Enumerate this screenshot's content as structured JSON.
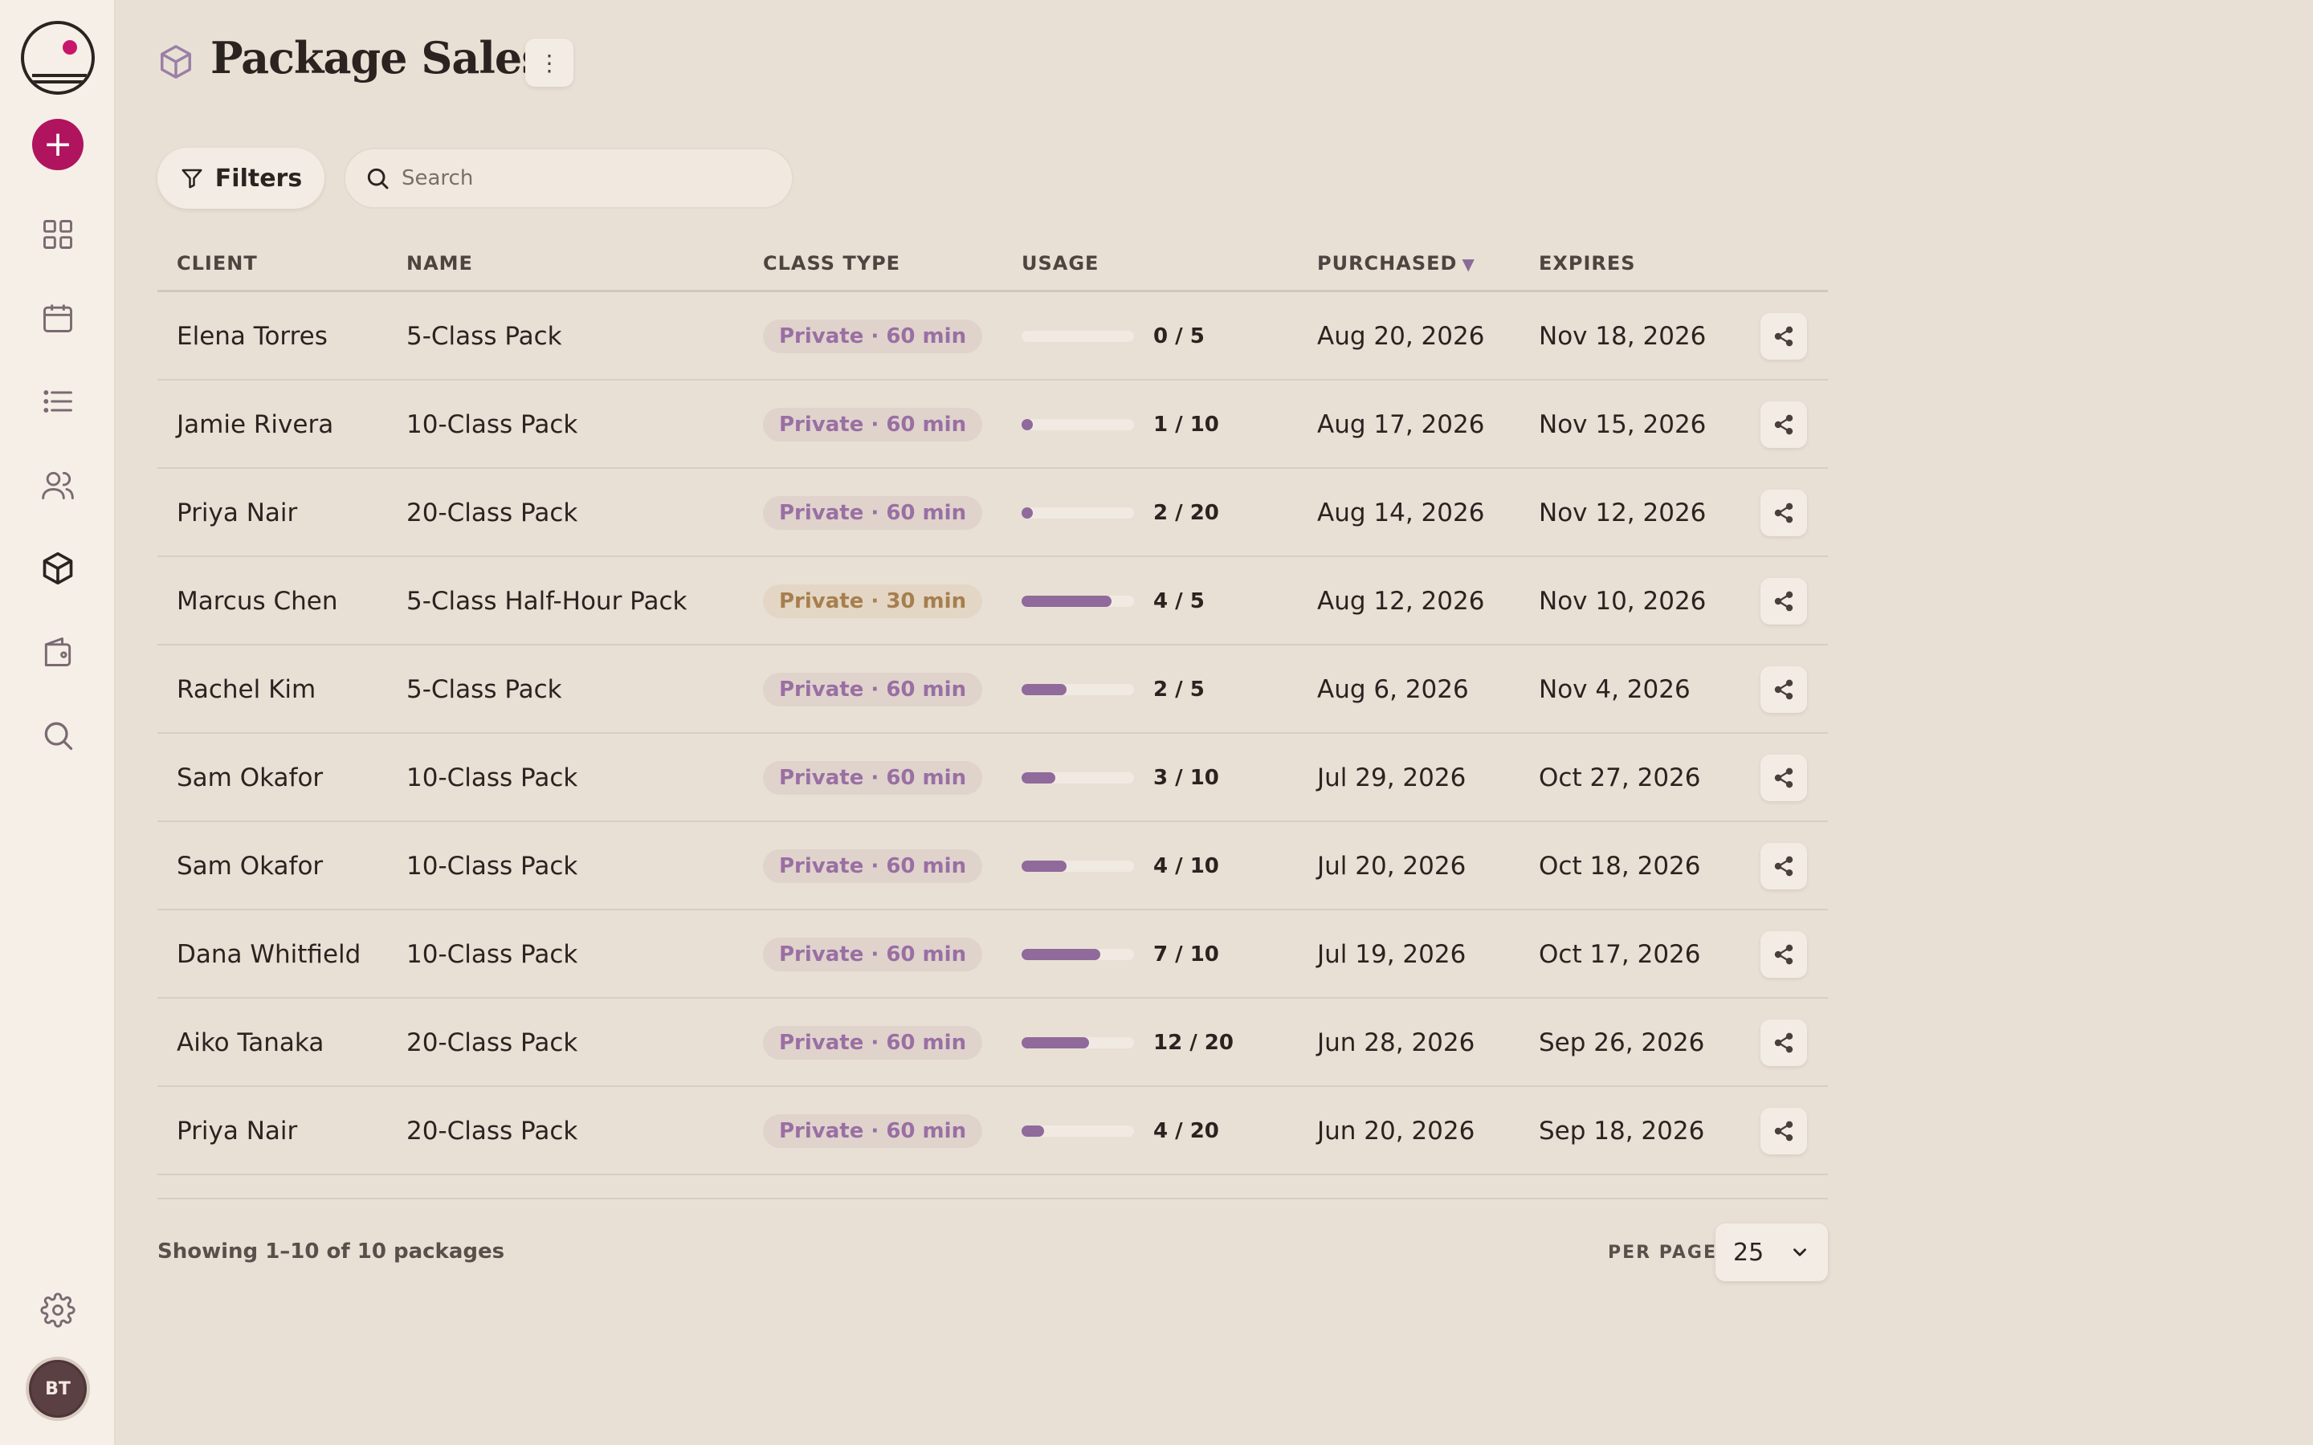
{
  "sidebar": {
    "items": [
      {
        "icon": "dashboard-icon"
      },
      {
        "icon": "calendar-icon"
      },
      {
        "icon": "list-icon"
      },
      {
        "icon": "clients-icon"
      },
      {
        "icon": "package-icon",
        "active": true
      },
      {
        "icon": "wallet-icon"
      },
      {
        "icon": "search-icon"
      }
    ],
    "add_label": "+",
    "user_initials": "BT"
  },
  "header": {
    "title": "Package Sales",
    "menu_glyph": "⋮"
  },
  "toolbar": {
    "filters_label": "Filters",
    "search_placeholder": "Search"
  },
  "table": {
    "columns": {
      "client": "CLIENT",
      "name": "NAME",
      "class_type": "CLASS TYPE",
      "usage": "USAGE",
      "purchased": "PURCHASED",
      "expires": "EXPIRES"
    },
    "sort_indicator": "▼",
    "rows": [
      {
        "client": "Elena Torres",
        "name": "5-Class Pack",
        "class_type": "Private · 60 min",
        "used": 0,
        "total": 5,
        "usage": "0 / 5",
        "purchased": "Aug 20, 2026",
        "expires": "Nov 18, 2026"
      },
      {
        "client": "Jamie Rivera",
        "name": "10-Class Pack",
        "class_type": "Private · 60 min",
        "used": 1,
        "total": 10,
        "usage": "1 / 10",
        "purchased": "Aug 17, 2026",
        "expires": "Nov 15, 2026"
      },
      {
        "client": "Priya Nair",
        "name": "20-Class Pack",
        "class_type": "Private · 60 min",
        "used": 2,
        "total": 20,
        "usage": "2 / 20",
        "purchased": "Aug 14, 2026",
        "expires": "Nov 12, 2026"
      },
      {
        "client": "Marcus Chen",
        "name": "5-Class Half-Hour Pack",
        "class_type": "Private · 30 min",
        "used": 4,
        "total": 5,
        "usage": "4 / 5",
        "purchased": "Aug 12, 2026",
        "expires": "Nov 10, 2026"
      },
      {
        "client": "Rachel Kim",
        "name": "5-Class Pack",
        "class_type": "Private · 60 min",
        "used": 2,
        "total": 5,
        "usage": "2 / 5",
        "purchased": "Aug 6, 2026",
        "expires": "Nov 4, 2026"
      },
      {
        "client": "Sam Okafor",
        "name": "10-Class Pack",
        "class_type": "Private · 60 min",
        "used": 3,
        "total": 10,
        "usage": "3 / 10",
        "purchased": "Jul 29, 2026",
        "expires": "Oct 27, 2026"
      },
      {
        "client": "Sam Okafor",
        "name": "10-Class Pack",
        "class_type": "Private · 60 min",
        "used": 4,
        "total": 10,
        "usage": "4 / 10",
        "purchased": "Jul 20, 2026",
        "expires": "Oct 18, 2026"
      },
      {
        "client": "Dana Whitfield",
        "name": "10-Class Pack",
        "class_type": "Private · 60 min",
        "used": 7,
        "total": 10,
        "usage": "7 / 10",
        "purchased": "Jul 19, 2026",
        "expires": "Oct 17, 2026"
      },
      {
        "client": "Aiko Tanaka",
        "name": "20-Class Pack",
        "class_type": "Private · 60 min",
        "used": 12,
        "total": 20,
        "usage": "12 / 20",
        "purchased": "Jun 28, 2026",
        "expires": "Sep 26, 2026"
      },
      {
        "client": "Priya Nair",
        "name": "20-Class Pack",
        "class_type": "Private · 60 min",
        "used": 4,
        "total": 20,
        "usage": "4 / 20",
        "purchased": "Jun 20, 2026",
        "expires": "Sep 18, 2026"
      }
    ]
  },
  "footer": {
    "showing": "Showing 1–10 of 10 packages",
    "per_page_label": "PER PAGE",
    "per_page_value": "25"
  },
  "colors": {
    "accent": "#b0145f",
    "usage_bar": "#8f6a9b",
    "pill_60": "#9a6fa3",
    "pill_30": "#a67f4e",
    "background": "#e8e0d5",
    "sidebar": "#f6efe7"
  }
}
